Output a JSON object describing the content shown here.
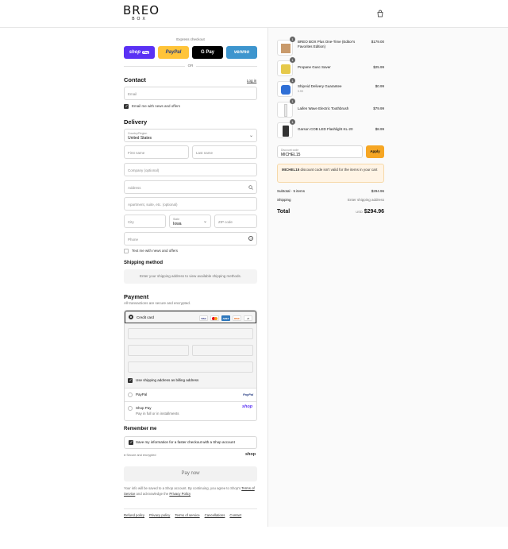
{
  "brand": {
    "line1": "BREO",
    "line2": "BOX"
  },
  "express": {
    "label": "Express checkout",
    "buttons": [
      {
        "name": "shop-pay",
        "label": "shop",
        "badge": "Pay",
        "color": "#5a31f4"
      },
      {
        "name": "paypal",
        "label": "PayPal",
        "color": "#ffc439"
      },
      {
        "name": "gpay",
        "label": "G Pay",
        "color": "#000000"
      },
      {
        "name": "venmo",
        "label": "venmo",
        "color": "#3d95ce"
      }
    ],
    "or": "OR"
  },
  "contact": {
    "title": "Contact",
    "login": "Log in",
    "email_placeholder": "Email",
    "news_label": "Email me with news and offers"
  },
  "delivery": {
    "title": "Delivery",
    "country_label": "Country/Region",
    "country_value": "United States",
    "first_name": "First name",
    "last_name": "Last name",
    "company": "Company (optional)",
    "address": "Address",
    "apartment": "Apartment, suite, etc. (optional)",
    "city": "City",
    "state_label": "State",
    "state_value": "Iowa",
    "zip": "ZIP code",
    "phone": "Phone",
    "text_label": "Text me with news and offers"
  },
  "shipping": {
    "title": "Shipping method",
    "note": "Enter your shipping address to view available shipping methods."
  },
  "payment": {
    "title": "Payment",
    "subtitle": "All transactions are secure and encrypted.",
    "credit_card": "Credit card",
    "card_brands": [
      "VISA",
      "MC",
      "AMEX",
      "DISC"
    ],
    "more": "+5",
    "billing_label": "Use shipping address as billing address",
    "paypal": "PayPal",
    "paypal_logo": "PayPal",
    "shop_pay": "Shop Pay",
    "shop_pay_sub": "Pay in full or in installments",
    "shop_logo": "shop"
  },
  "remember": {
    "title": "Remember me",
    "label": "Save my information for a faster checkout with a Shop account",
    "secure": "Secure and encrypted",
    "shop_logo": "shop"
  },
  "pay_now": "Pay now",
  "legal": {
    "text1": "Your info will be saved to a Shop account. By continuing, you agree to Shop's",
    "terms": "Terms of Service",
    "text2": "and acknowledge the",
    "privacy": "Privacy Policy"
  },
  "footer_links": [
    "Refund policy",
    "Privacy policy",
    "Terms of service",
    "Cancellations",
    "Contact"
  ],
  "cart": {
    "items": [
      {
        "qty": "1",
        "name": "BREO BOX Plus One-Time (Editor's Favorites Edition)",
        "sub": "",
        "price": "$179.00"
      },
      {
        "qty": "1",
        "name": "Propane Gusc Saver",
        "sub": "",
        "price": "$25.99"
      },
      {
        "qty": "1",
        "name": "ShipAid Delivery Guarantee",
        "sub": "0.99",
        "price": "$0.99"
      },
      {
        "qty": "1",
        "name": "Laifen Wave Electric Toothbrush",
        "sub": "",
        "price": "$79.99"
      },
      {
        "qty": "1",
        "name": "Garson COB LED Flashlight KL-20",
        "sub": "",
        "price": "$8.99"
      }
    ],
    "discount_label": "Discount code",
    "discount_value": "MICHEL15",
    "apply": "Apply",
    "warning_code": "MICHEL15",
    "warning_rest": "discount code isn't valid for the items in your cart",
    "subtotal_label": "Subtotal · 5 items",
    "subtotal_value": "$294.96",
    "shipping_label": "Shipping",
    "shipping_value": "Enter shipping address",
    "total_label": "Total",
    "currency": "USD",
    "total_value": "$294.96"
  }
}
